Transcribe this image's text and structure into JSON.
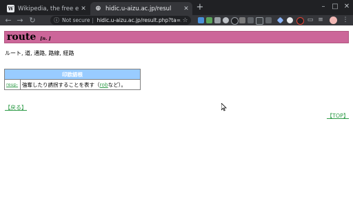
{
  "browser": {
    "tabs": [
      {
        "title": "Wikipedia, the free enc",
        "favicon": "W",
        "active": false
      },
      {
        "title": "hidic.u-aizu.ac.jp/resul",
        "favicon": "globe",
        "active": true
      }
    ],
    "new_tab": "+",
    "window_controls": {
      "minimize": "–",
      "maximize": "□",
      "close": "✕"
    },
    "nav": {
      "back": "←",
      "forward": "→",
      "reload": "↻"
    },
    "omnibox": {
      "security_label": "Not secure",
      "url": "hidic.u-aizu.ac.jp/result.php?ta=..."
    }
  },
  "entry": {
    "headword": "route",
    "pos": "[n. ]",
    "meanings": "ルート, 道, 通路, 路線, 経路"
  },
  "idioms": {
    "header": "印欧語根",
    "rows": [
      {
        "term": "reup-",
        "description_before": "強奪したり誘拐することを表す（",
        "link": "rob",
        "description_after": "など）。"
      }
    ]
  },
  "links": {
    "back": "【戻る】",
    "top": "【TOP】"
  },
  "colors": {
    "header_bg": "#cc6699",
    "table_header_bg": "#99ccff",
    "link": "#2e9b47"
  }
}
